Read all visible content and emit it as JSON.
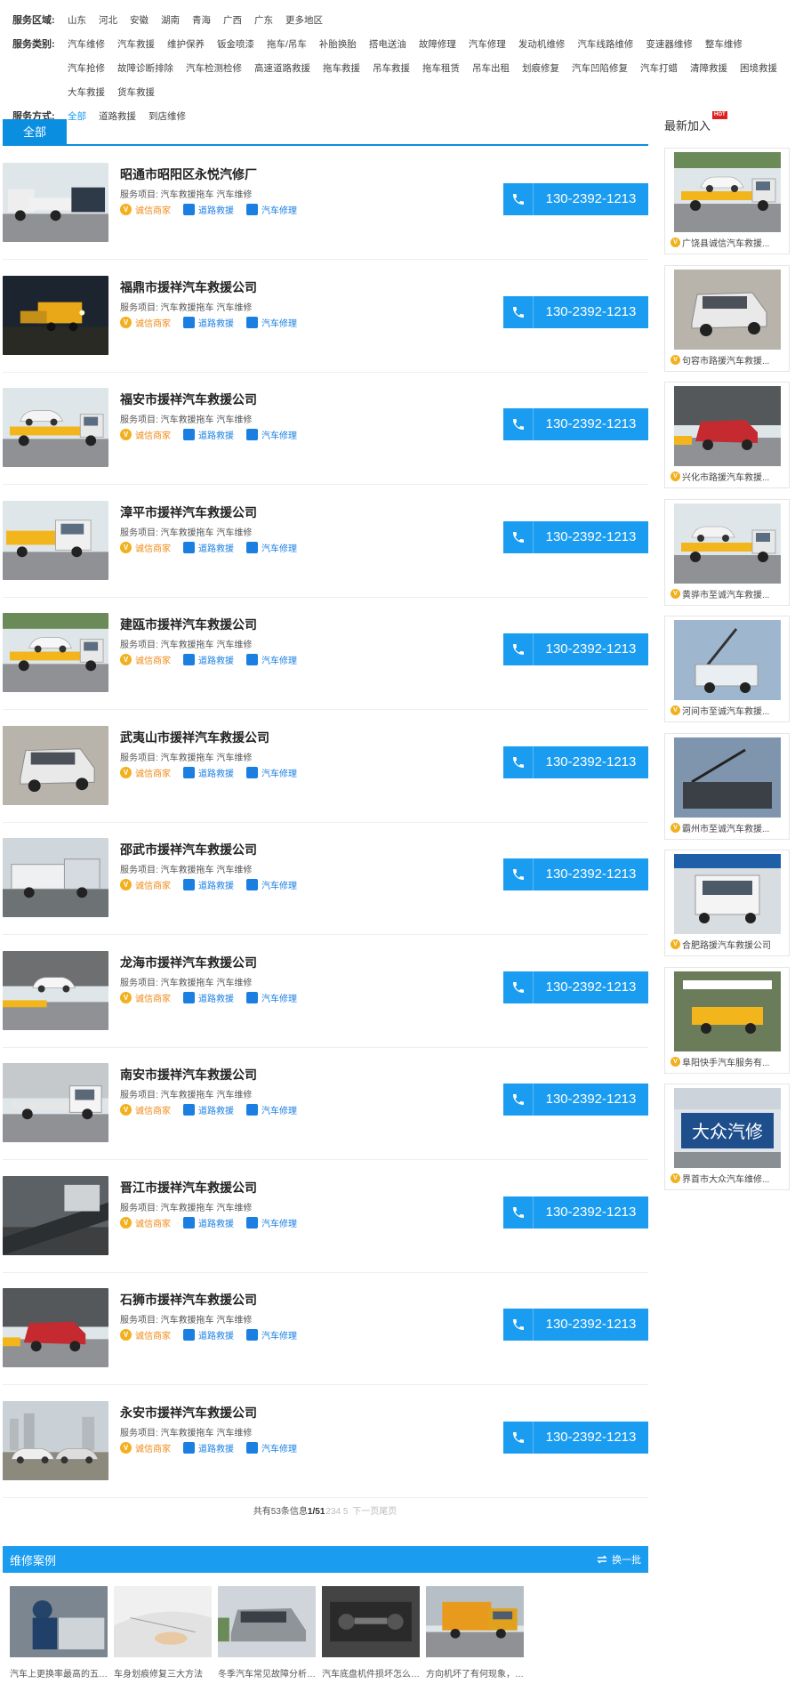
{
  "filters": [
    {
      "label": "服务区域:",
      "options": [
        "山东",
        "河北",
        "安徽",
        "湖南",
        "青海",
        "广西",
        "广东",
        "更多地区"
      ]
    },
    {
      "label": "服务类别:",
      "options": [
        "汽车维修",
        "汽车救援",
        "维护保养",
        "钣金喷漆",
        "拖车/吊车",
        "补胎换胎",
        "搭电送油",
        "故障修理",
        "汽车修理",
        "发动机维修",
        "汽车线路维修",
        "变速器维修",
        "整车维修",
        "汽车抢修",
        "故障诊断排除",
        "汽车检测检修",
        "高速道路救援",
        "拖车救援",
        "吊车救援",
        "拖车租赁",
        "吊车出租",
        "划痕修复",
        "汽车凹陷修复",
        "汽车打蜡",
        "清障救援",
        "困境救援",
        "大车救援",
        "货车救援"
      ]
    },
    {
      "label": "服务方式:",
      "options": [
        "全部",
        "道路救援",
        "到店维修"
      ],
      "active": 0
    }
  ],
  "tab": "全部",
  "listing": {
    "service_prefix": "服务项目:",
    "tag_vip": "诚信商家",
    "tag_road": "道路救援",
    "tag_repair": "汽车修理",
    "items": [
      {
        "name": "昭通市昭阳区永悦汽修厂",
        "services": "汽车救援拖车 汽车维修",
        "phone": "130-2392-1213",
        "img": "truck1"
      },
      {
        "name": "福鼎市援祥汽车救援公司",
        "services": "汽车救援拖车 汽车维修",
        "phone": "130-2392-1213",
        "img": "night"
      },
      {
        "name": "福安市援祥汽车救援公司",
        "services": "汽车救援拖车 汽车维修",
        "phone": "130-2392-1213",
        "img": "white_car"
      },
      {
        "name": "漳平市援祥汽车救援公司",
        "services": "汽车救援拖车 汽车维修",
        "phone": "130-2392-1213",
        "img": "yellow_truck"
      },
      {
        "name": "建瓯市援祥汽车救援公司",
        "services": "汽车救援拖车 汽车维修",
        "phone": "130-2392-1213",
        "img": "yellow_white"
      },
      {
        "name": "武夷山市援祥汽车救援公司",
        "services": "汽车救援拖车 汽车维修",
        "phone": "130-2392-1213",
        "img": "suv"
      },
      {
        "name": "邵武市援祥汽车救援公司",
        "services": "汽车救援拖车 汽车维修",
        "phone": "130-2392-1213",
        "img": "wreck"
      },
      {
        "name": "龙海市援祥汽车救援公司",
        "services": "汽车救援拖车 汽车维修",
        "phone": "130-2392-1213",
        "img": "white_sedan"
      },
      {
        "name": "南安市援祥汽车救援公司",
        "services": "汽车救援拖车 汽车维修",
        "phone": "130-2392-1213",
        "img": "flatbed"
      },
      {
        "name": "晋江市援祥汽车救援公司",
        "services": "汽车救援拖车 汽车维修",
        "phone": "130-2392-1213",
        "img": "ramp"
      },
      {
        "name": "石狮市援祥汽车救援公司",
        "services": "汽车救援拖车 汽车维修",
        "phone": "130-2392-1213",
        "img": "red_suv"
      },
      {
        "name": "永安市援祥汽车救援公司",
        "services": "汽车救援拖车 汽车维修",
        "phone": "130-2392-1213",
        "img": "lot"
      }
    ]
  },
  "pager": {
    "prefix": "共有53条信息",
    "current": "1/51",
    "pages": "234 5",
    "next": "下一页尾页"
  },
  "sidebar": {
    "title": "最新加入",
    "hot": "HOT",
    "items": [
      "广饶县诚信汽车救援...",
      "句容市路援汽车救援...",
      "兴化市路援汽车救援...",
      "黄骅市至诚汽车救援...",
      "河间市至诚汽车救援...",
      "霸州市至诚汽车救援...",
      "合肥路援汽车救援公司",
      "阜阳快手汽车服务有...",
      "界首市大众汽车维修..."
    ]
  },
  "cases": {
    "title": "维修案例",
    "swap": "换一批",
    "items": [
      "汽车上更换率最高的五个配...",
      "车身划痕修复三大方法",
      "冬季汽车常见故障分析和解...",
      "汽车底盘机件损坏怎么办?",
      "方向机坏了有何现象，车还..."
    ]
  },
  "colors": {
    "accent": "#1a9cf0",
    "vip": "#f2b01e",
    "tag_blue": "#1a7fe0"
  }
}
